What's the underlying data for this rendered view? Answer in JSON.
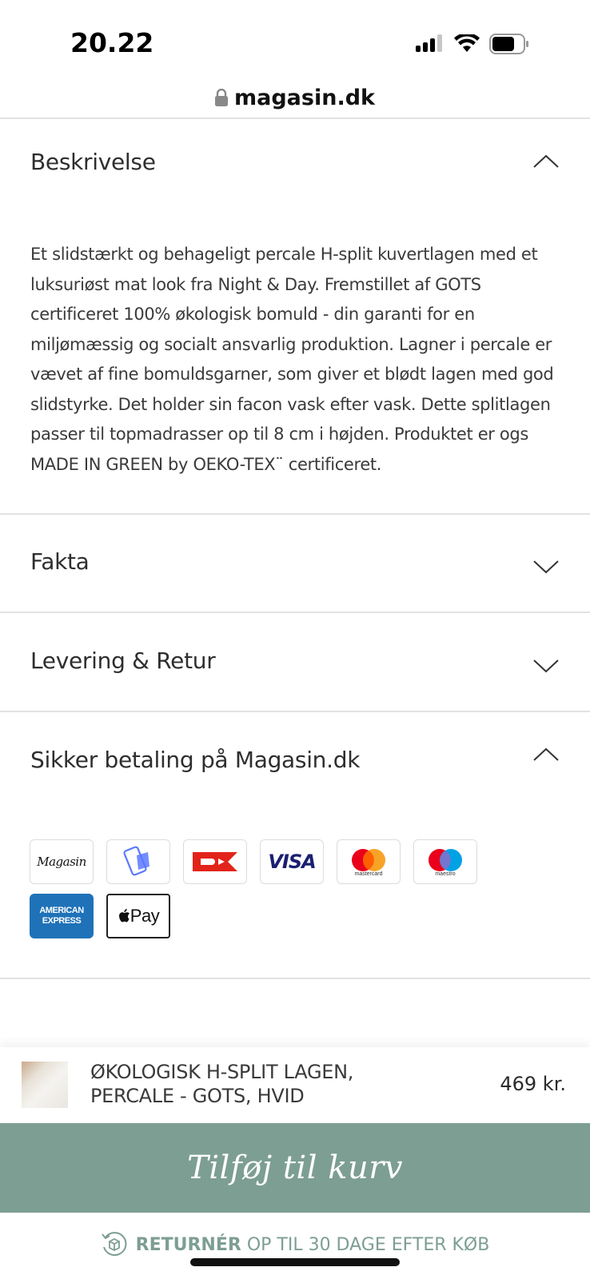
{
  "status_bar": {
    "time": "20.22"
  },
  "browser": {
    "url": "magasin.dk"
  },
  "sections": {
    "description": {
      "title": "Beskrivelse",
      "expanded": true,
      "text": "Et slidstærkt og behageligt percale H-split kuvertlagen med et luksuriøst mat look fra Night & Day. Fremstillet af GOTS certificeret 100% økologisk bomuld - din garanti for en miljømæssig og socialt ansvarlig produktion. Lagner i percale er vævet af fine bomuldsgarner, som giver et blødt lagen med god slidstyrke. Det holder sin facon vask efter vask. Dette splitlagen passer til topmadrasser op til 8 cm i højden. Produktet er ogs MADE IN GREEN by OEKO-TEX¨ certificeret."
    },
    "facts": {
      "title": "Fakta",
      "expanded": false
    },
    "delivery": {
      "title": "Levering & Retur",
      "expanded": false
    },
    "payment": {
      "title": "Sikker betaling på Magasin.dk",
      "expanded": true
    }
  },
  "payment_methods": {
    "magasin": "Magasin",
    "mobilepay": "mobilepay-icon",
    "dankort": "dankort-icon",
    "visa": "VISA",
    "mastercard": "mastercard",
    "maestro": "maestro",
    "amex_line1": "AMERICAN",
    "amex_line2": "EXPRESS",
    "applepay": "Pay"
  },
  "product": {
    "name_line1": "ØKOLOGISK H-SPLIT LAGEN,",
    "name_line2": "PERCALE - GOTS, HVID",
    "price": "469 kr."
  },
  "cta": {
    "add_to_cart": "Tilføj til kurv"
  },
  "returns": {
    "bold": "RETURNÉR",
    "rest": "OP TIL 30 DAGE EFTER KØB"
  },
  "colors": {
    "accent": "#7d9e93",
    "divider": "#e2e2e2"
  }
}
